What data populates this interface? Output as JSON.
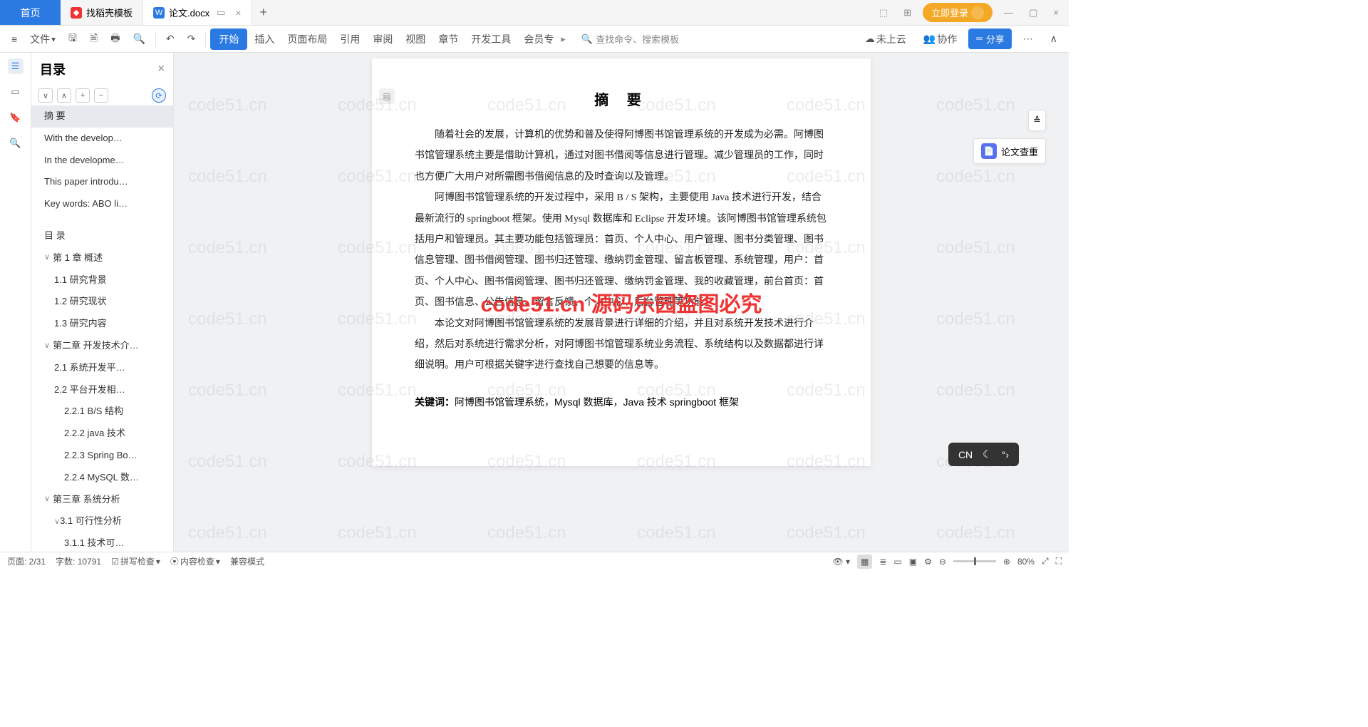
{
  "tabs": {
    "home": "首页",
    "items": [
      {
        "label": "找稻壳模板",
        "color": "#e33"
      },
      {
        "label": "论文.docx",
        "color": "#2a7ae2"
      }
    ]
  },
  "topright": {
    "login": "立即登录"
  },
  "ribbon": {
    "file": "文件",
    "menus": [
      "开始",
      "插入",
      "页面布局",
      "引用",
      "审阅",
      "视图",
      "章节",
      "开发工具",
      "会员专"
    ],
    "search": "查找命令、搜索模板",
    "cloud": "未上云",
    "coop": "协作",
    "share": "分享"
  },
  "sidebar": {
    "title": "目录",
    "tools": [
      "∨",
      "∧",
      "+",
      "−"
    ],
    "toc": [
      {
        "t": "摘  要",
        "l": 1,
        "sel": true
      },
      {
        "t": "With the develop…",
        "l": 1
      },
      {
        "t": "In the developme…",
        "l": 1
      },
      {
        "t": "This paper introdu…",
        "l": 1
      },
      {
        "t": "Key words: ABO li…",
        "l": 1
      },
      {
        "t": "目  录",
        "l": 1,
        "gap": true
      },
      {
        "t": "第 1 章  概述",
        "l": 1,
        "exp": "∨"
      },
      {
        "t": "1.1 研究背景",
        "l": 2
      },
      {
        "t": "1.2 研究现状",
        "l": 2
      },
      {
        "t": "1.3 研究内容",
        "l": 2
      },
      {
        "t": "第二章 开发技术介…",
        "l": 1,
        "exp": "∨"
      },
      {
        "t": "2.1  系统开发平…",
        "l": 2
      },
      {
        "t": "2.2 平台开发相…",
        "l": 2
      },
      {
        "t": "2.2.1 B/S 结构",
        "l": 3
      },
      {
        "t": "2.2.2 java 技术",
        "l": 3
      },
      {
        "t": "2.2.3 Spring Bo…",
        "l": 3
      },
      {
        "t": "2.2.4 MySQL 数…",
        "l": 3
      },
      {
        "t": "第三章  系统分析",
        "l": 1,
        "exp": "∨"
      },
      {
        "t": "3.1 可行性分析",
        "l": 2,
        "exp": "∨"
      },
      {
        "t": "3.1.1  技术可…",
        "l": 3
      },
      {
        "t": "3.1.2 经济可…",
        "l": 3
      },
      {
        "t": "3.1.3 操作可…",
        "l": 3
      }
    ]
  },
  "doc": {
    "title": "摘  要",
    "p1": "随着社会的发展，计算机的优势和普及使得阿博图书馆管理系统的开发成为必需。阿博图书馆管理系统主要是借助计算机，通过对图书借阅等信息进行管理。减少管理员的工作，同时也方便广大用户对所需图书借阅信息的及时查询以及管理。",
    "p2": "阿博图书馆管理系统的开发过程中，采用 B / S 架构，主要使用 Java 技术进行开发，结合最新流行的 springboot 框架。使用 Mysql 数据库和 Eclipse 开发环境。该阿博图书馆管理系统包括用户和管理员。其主要功能包括管理员：首页、个人中心、用户管理、图书分类管理、图书信息管理、图书借阅管理、图书归还管理、缴纳罚金管理、留言板管理、系统管理，用户：首页、个人中心、图书借阅管理、图书归还管理、缴纳罚金管理、我的收藏管理，前台首页：首页、图书信息、公告信息、留言反馈、个人中心、后台管理等功能。",
    "p3": "本论文对阿博图书馆管理系统的发展背景进行详细的介绍，并且对系统开发技术进行介绍，然后对系统进行需求分析，对阿博图书馆管理系统业务流程、系统结构以及数据都进行详细说明。用户可根据关键字进行查找自己想要的信息等。",
    "kw_label": "关键词：",
    "kw_text": "阿博图书馆管理系统，Mysql 数据库，Java 技术  springboot 框架"
  },
  "watermark": {
    "center": "code51.cn 源码乐园盗图必究",
    "bg": "code51.cn"
  },
  "rightfloat": {
    "check": "论文查重"
  },
  "ime": {
    "lang": "CN"
  },
  "status": {
    "page": "页面: 2/31",
    "words": "字数: 10791",
    "spell": "拼写检查",
    "content": "内容检查",
    "compat": "兼容模式",
    "zoom": "80%"
  }
}
